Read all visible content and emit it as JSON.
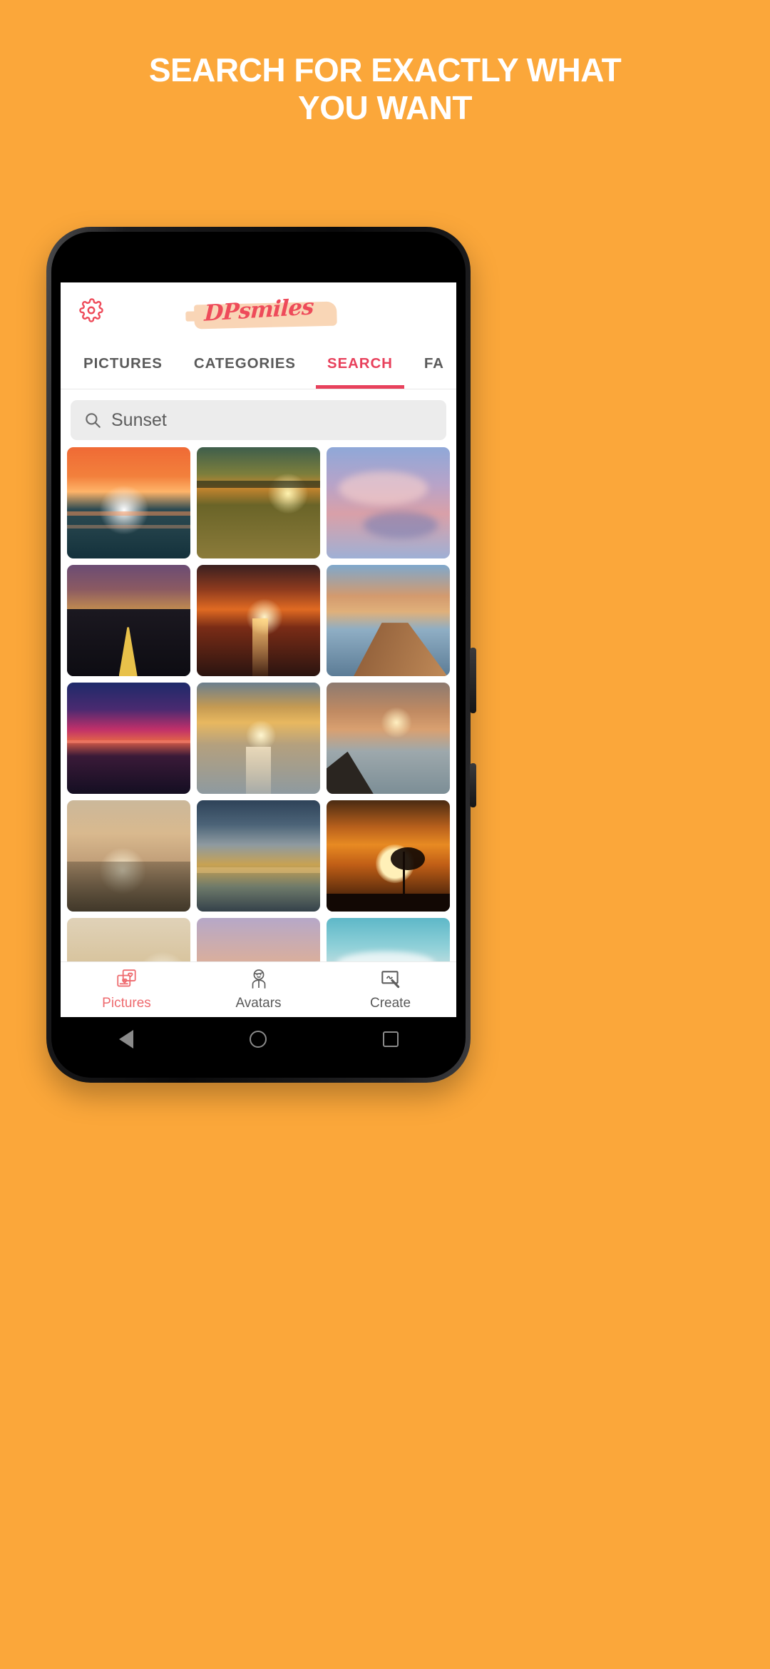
{
  "promo": {
    "line1": "SEARCH FOR EXACTLY WHAT",
    "line2": "YOU WANT",
    "text_color": "#FFFFFF",
    "background_color": "#FBA73A"
  },
  "app": {
    "logo_text": "DPsmiles",
    "accent_color": "#E8415C",
    "settings_icon": "gear-icon",
    "tabs": [
      {
        "label": "PICTURES",
        "active": false
      },
      {
        "label": "CATEGORIES",
        "active": false
      },
      {
        "label": "SEARCH",
        "active": true
      },
      {
        "label": "FA",
        "active": false
      }
    ],
    "search": {
      "value": "Sunset",
      "placeholder": "Sunset",
      "icon": "search-icon"
    },
    "gallery": {
      "columns": 3,
      "items": [
        {
          "alt": "ocean-sunset-orange-sky"
        },
        {
          "alt": "field-grass-sunset"
        },
        {
          "alt": "pink-purple-clouds"
        },
        {
          "alt": "palm-road-silhouette-sunset"
        },
        {
          "alt": "sea-sunset-reflection"
        },
        {
          "alt": "lake-pier-dock-sunset"
        },
        {
          "alt": "purple-magenta-sea-dusk"
        },
        {
          "alt": "misty-lake-boat-golden"
        },
        {
          "alt": "beach-cliff-moody-sunset"
        },
        {
          "alt": "wild-flowers-backlit-sun"
        },
        {
          "alt": "blue-dramatic-clouds-shore"
        },
        {
          "alt": "lone-tree-orange-sun"
        },
        {
          "alt": "couple-beach-silhouette"
        },
        {
          "alt": "pastel-horizon-sunset"
        },
        {
          "alt": "teal-sky-clouds"
        }
      ]
    },
    "bottom_nav": [
      {
        "label": "Pictures",
        "icon": "photo-frames-heart-icon",
        "active": true
      },
      {
        "label": "Avatars",
        "icon": "person-avatar-icon",
        "active": false
      },
      {
        "label": "Create",
        "icon": "canvas-brush-icon",
        "active": false
      }
    ]
  },
  "system_nav": {
    "back": "back-triangle-icon",
    "home": "home-circle-icon",
    "recents": "recents-square-icon"
  }
}
